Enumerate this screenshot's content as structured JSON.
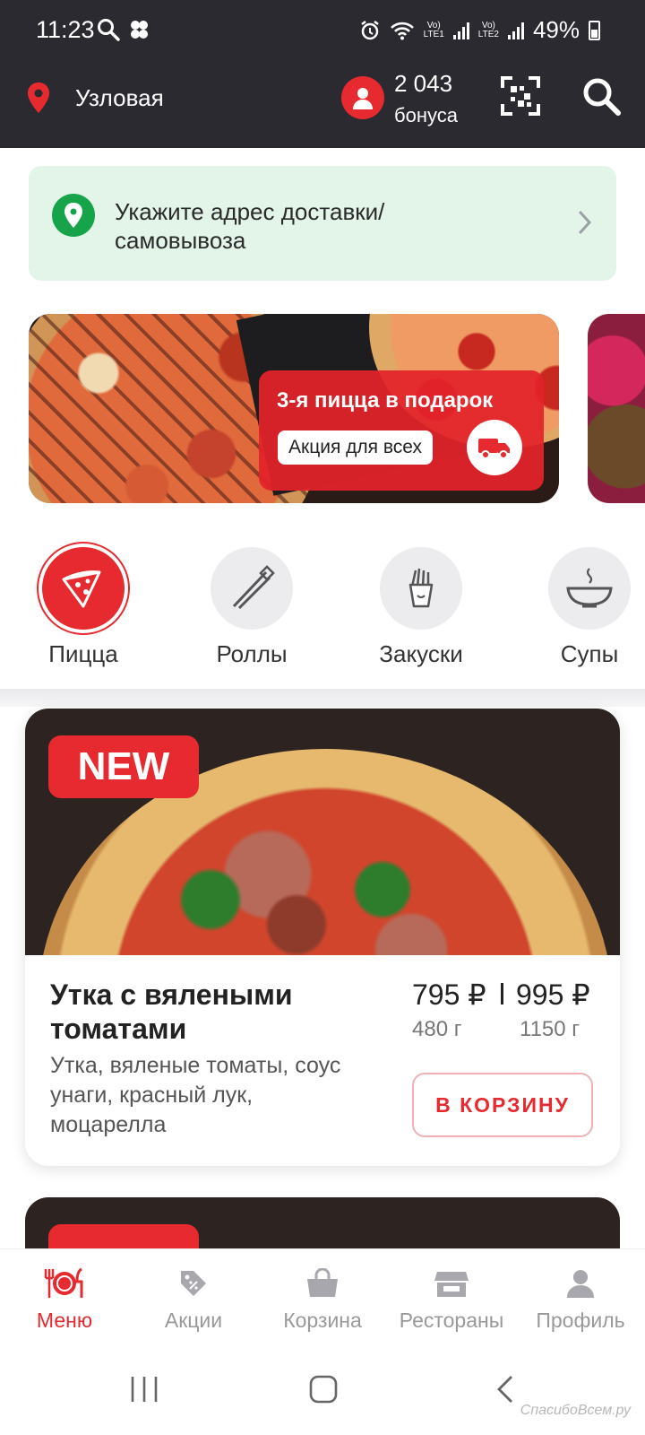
{
  "status_bar": {
    "time": "11:23",
    "battery": "49%",
    "sim1": "LTE1",
    "sim2": "LTE2",
    "volte": "Vo)"
  },
  "header": {
    "city": "Узловая",
    "bonus_count": "2 043",
    "bonus_label": "бонуса"
  },
  "address_banner": {
    "text": "Укажите адрес доставки/ самовывоза"
  },
  "promo": {
    "title": "3-я пицца в подарок",
    "pill": "Акция для всех"
  },
  "categories": [
    {
      "label": "Пицца",
      "icon": "pizza-slice-icon",
      "active": true
    },
    {
      "label": "Роллы",
      "icon": "chopsticks-icon",
      "active": false
    },
    {
      "label": "Закуски",
      "icon": "fries-icon",
      "active": false
    },
    {
      "label": "Супы",
      "icon": "soup-bowl-icon",
      "active": false
    }
  ],
  "product": {
    "badge": "NEW",
    "name": "Утка с вялеными томатами",
    "description": "Утка, вяленые томаты, соус унаги, красный лук, моцарелла",
    "price_small": "795 ₽",
    "price_large": "995 ₽",
    "weight_small": "480 г",
    "weight_large": "1150 г",
    "cart_button": "В КОРЗИНУ"
  },
  "bottom_nav": [
    {
      "label": "Меню",
      "icon": "menu-plate-icon",
      "active": true
    },
    {
      "label": "Акции",
      "icon": "discount-tag-icon",
      "active": false
    },
    {
      "label": "Корзина",
      "icon": "basket-icon",
      "active": false
    },
    {
      "label": "Рестораны",
      "icon": "store-icon",
      "active": false
    },
    {
      "label": "Профиль",
      "icon": "profile-icon",
      "active": false
    }
  ],
  "watermark": "СпасибоВсем.ру",
  "colors": {
    "accent": "#e62a2f",
    "header_bg": "#2b2a30",
    "banner_bg": "#e3f4e9",
    "location_green": "#17a34a"
  }
}
